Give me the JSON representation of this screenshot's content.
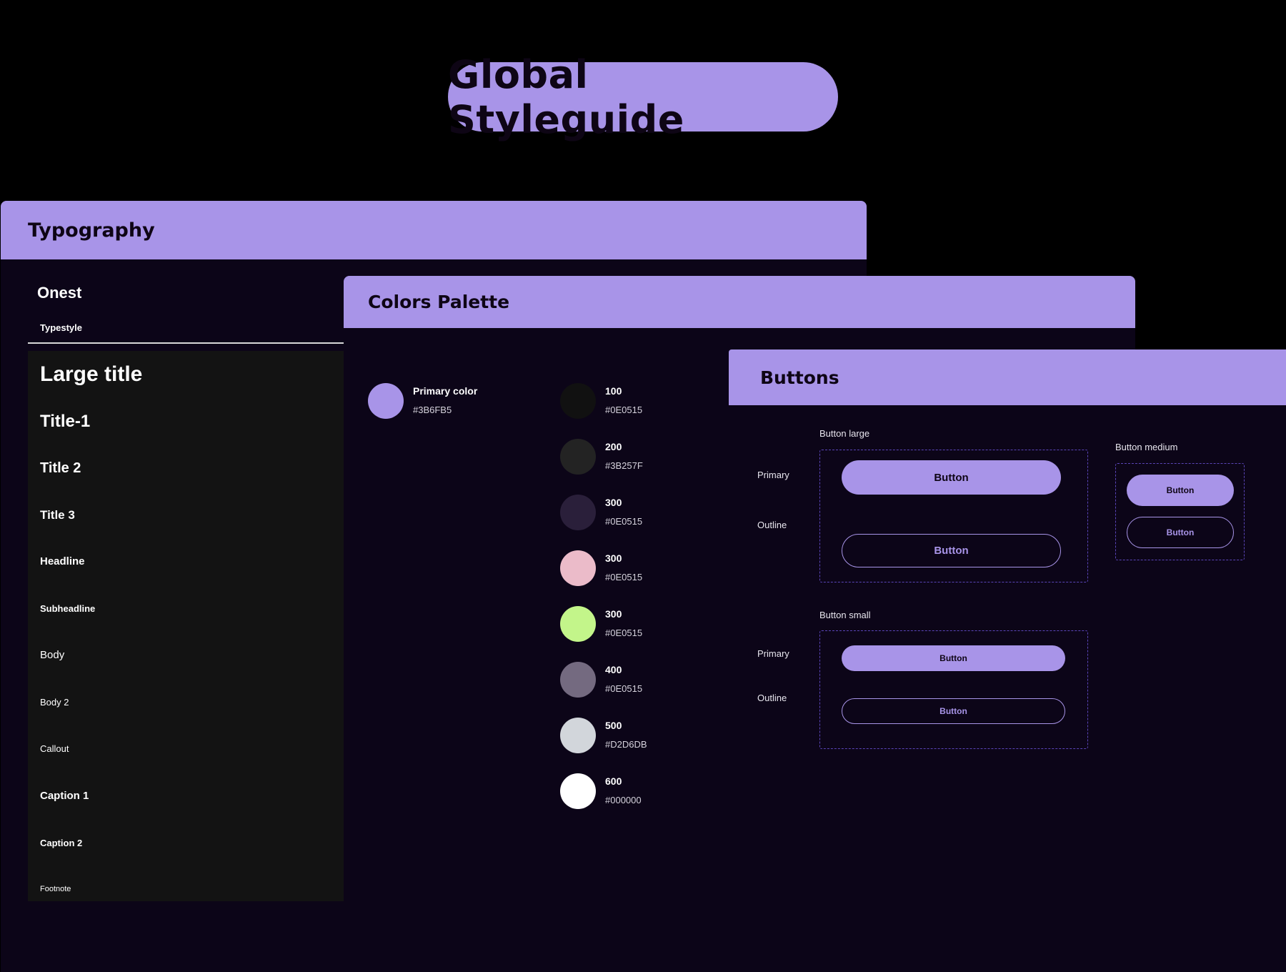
{
  "page": {
    "title": "Global Styleguide",
    "colors": {
      "accent": "#A894E8",
      "background": "#000000",
      "panel": "#0C0518",
      "type_list_bg": "#131313"
    }
  },
  "typography": {
    "header": "Typography",
    "font_name": "Onest",
    "typestyle_label": "Typestyle",
    "styles": [
      {
        "label": "Large title"
      },
      {
        "label": "Title-1"
      },
      {
        "label": "Title 2"
      },
      {
        "label": "Title 3"
      },
      {
        "label": "Headline"
      },
      {
        "label": "Subheadline"
      },
      {
        "label": "Body"
      },
      {
        "label": "Body 2"
      },
      {
        "label": "Callout"
      },
      {
        "label": "Caption 1"
      },
      {
        "label": "Caption 2"
      },
      {
        "label": "Footnote"
      }
    ]
  },
  "colors_palette": {
    "header": "Colors Palette",
    "primary": {
      "name": "Primary color",
      "hex": "#3B6FB5",
      "swatch": "#A894E8"
    },
    "scale": [
      {
        "name": "100",
        "hex": "#0E0515",
        "swatch": "#111111"
      },
      {
        "name": "200",
        "hex": "#3B257F",
        "swatch": "#232323"
      },
      {
        "name": "300",
        "hex": "#0E0515",
        "swatch": "#2A1F3A"
      },
      {
        "name": "300",
        "hex": "#0E0515",
        "swatch": "#EBBBC9"
      },
      {
        "name": "300",
        "hex": "#0E0515",
        "swatch": "#C3F58A"
      },
      {
        "name": "400",
        "hex": "#0E0515",
        "swatch": "#746A80"
      },
      {
        "name": "500",
        "hex": "#D2D6DB",
        "swatch": "#D2D6DB"
      },
      {
        "name": "600",
        "hex": "#000000",
        "swatch": "#FFFFFF"
      }
    ]
  },
  "buttons": {
    "header": "Buttons",
    "large": {
      "label": "Button large",
      "primary_label": "Primary",
      "outline_label": "Outline",
      "primary_button": "Button",
      "outline_button": "Button"
    },
    "medium": {
      "label": "Button medium",
      "primary_button": "Button",
      "outline_button": "Button"
    },
    "small": {
      "label": "Button small",
      "primary_label": "Primary",
      "outline_label": "Outline",
      "primary_button": "Button",
      "outline_button": "Button"
    }
  }
}
